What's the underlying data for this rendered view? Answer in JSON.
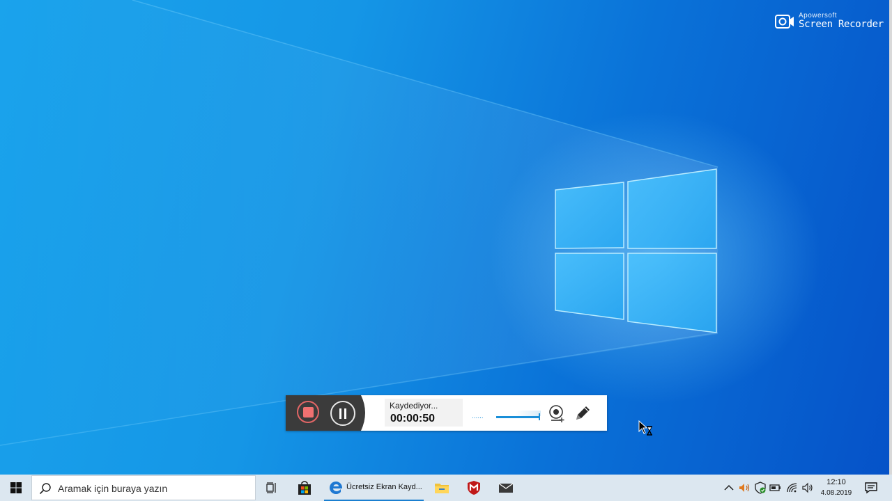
{
  "watermark": {
    "brand": "Apowersoft",
    "product": "Screen Recorder"
  },
  "recorder": {
    "status": "Kaydediyor...",
    "elapsed": "00:00:50",
    "stop_label": "stop",
    "pause_label": "pause",
    "volume_dots": "......"
  },
  "taskbar": {
    "search_placeholder": "Aramak için buraya yazın",
    "edge_task_label": "Ücretsiz Ekran Kayd...",
    "clock_time": "12:10",
    "clock_date": "4.08.2019"
  },
  "icons": {
    "start": "windows-logo-icon",
    "search": "search-icon",
    "task_view": "task-view-icon",
    "store": "store-icon",
    "edge": "edge-icon",
    "explorer": "folder-icon",
    "mcafee": "mcafee-icon",
    "mail": "mail-icon",
    "tray": [
      "chevron-up-icon",
      "speaker-icon",
      "shield-icon",
      "battery-icon",
      "wifi-icon",
      "volume-icon",
      "notification-icon"
    ]
  },
  "colors": {
    "accent": "#1a8fd8",
    "stop_red": "#f07171",
    "taskbar_bg": "#dce7f0",
    "recorder_dark": "#3b3b3b"
  }
}
